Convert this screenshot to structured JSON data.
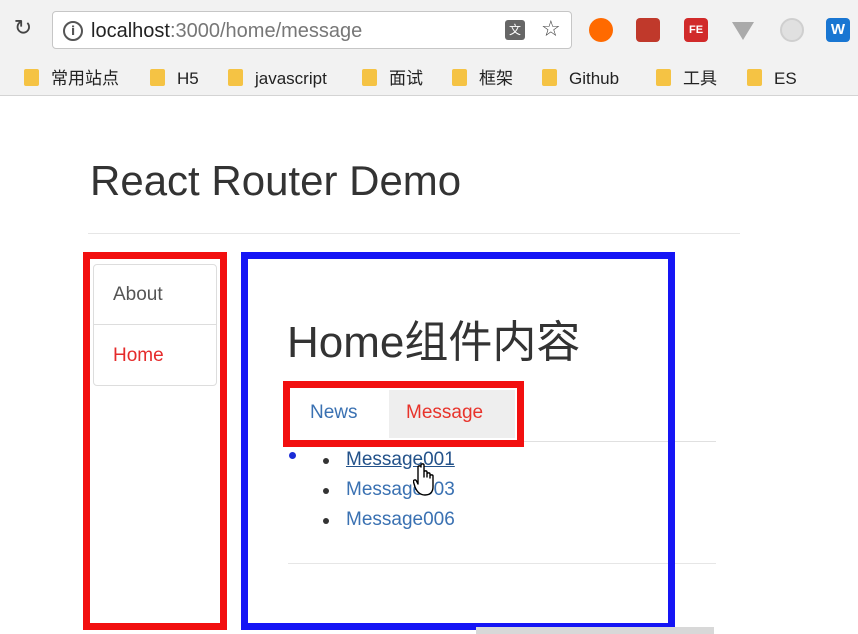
{
  "browser": {
    "url_host": "localhost",
    "url_path": ":3000/home/message",
    "bookmarks": [
      "常用站点",
      "H5",
      "javascript",
      "面试",
      "框架",
      "Github",
      "工具",
      "ES"
    ],
    "ext_fe_label": "FE",
    "ext_w_label": "W"
  },
  "page": {
    "title": "React Router Demo",
    "nav": [
      {
        "label": "About",
        "active": false
      },
      {
        "label": "Home",
        "active": true
      }
    ],
    "home_heading": "Home组件内容",
    "tabs": [
      {
        "label": "News",
        "active": false
      },
      {
        "label": "Message",
        "active": true
      }
    ],
    "messages": [
      "Message001",
      "Message003",
      "Message006"
    ]
  },
  "colors": {
    "active_link": "#e8332b",
    "link": "#3a71b2",
    "annotation_red": "#f20f0f",
    "annotation_blue": "#1515f5"
  }
}
